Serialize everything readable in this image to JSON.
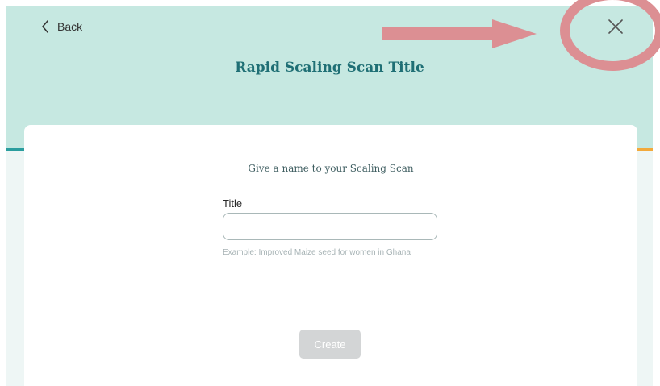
{
  "header": {
    "back_label": "Back",
    "title": "Rapid Scaling Scan Title"
  },
  "form": {
    "heading": "Give a name to your Scaling Scan",
    "title_label": "Title",
    "title_value": "",
    "helper_text": "Example: Improved Maize seed for women in Ghana",
    "create_label": "Create"
  },
  "icons": {
    "back": "chevron-left-icon",
    "close": "close-icon"
  },
  "colors": {
    "header_background": "#c6e8e1",
    "title_text": "#1f6f75",
    "accent_teal": "#2a9d9e",
    "accent_orange": "#f2a93b",
    "annotation": "#dc8f93",
    "button_disabled": "#d3d5d6"
  }
}
